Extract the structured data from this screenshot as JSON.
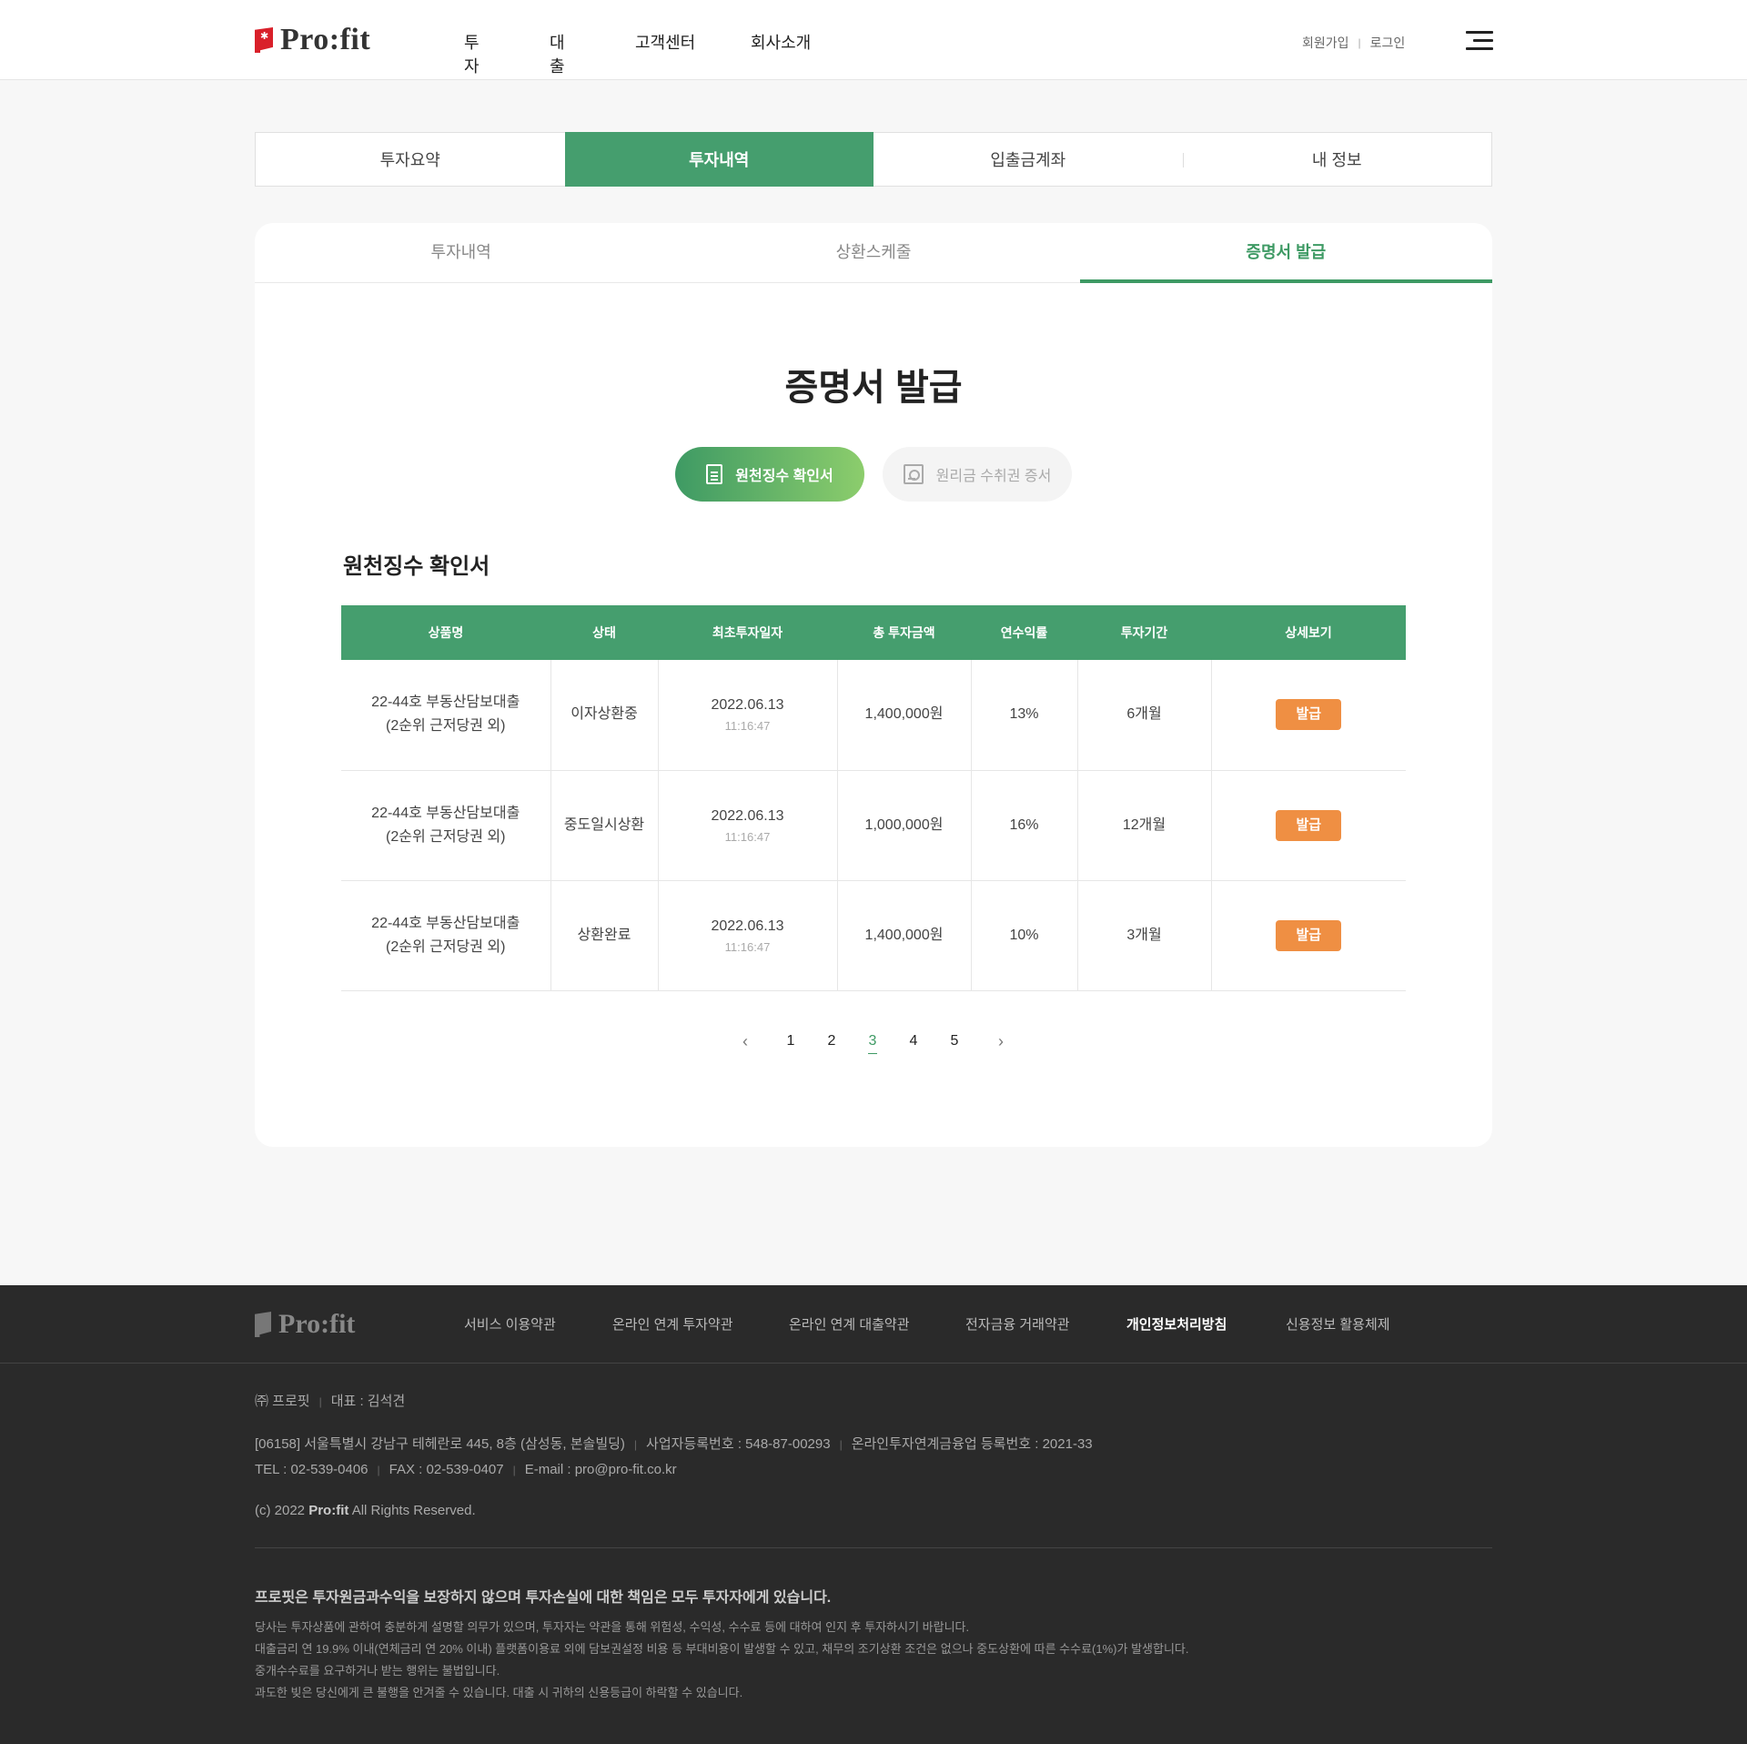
{
  "header": {
    "logo_text": "Pro:fit",
    "nav": [
      "투자",
      "대출",
      "고객센터",
      "회사소개"
    ],
    "signup": "회원가입",
    "login": "로그인"
  },
  "top_tabs": [
    "투자요약",
    "투자내역",
    "입출금계좌",
    "내 정보"
  ],
  "top_tabs_active": 1,
  "sub_tabs": [
    "투자내역",
    "상환스케줄",
    "증명서 발급"
  ],
  "sub_tabs_active": 2,
  "page_title": "증명서 발급",
  "toggle": {
    "primary": "원천징수 확인서",
    "secondary": "원리금 수취권 증서"
  },
  "section_title": "원천징수 확인서",
  "table": {
    "headers": [
      "상품명",
      "상태",
      "최초투자일자",
      "총 투자금액",
      "연수익률",
      "투자기간",
      "상세보기"
    ],
    "rows": [
      {
        "name1": "22-44호 부동산담보대출",
        "name2": "(2순위 근저당권 외)",
        "status": "이자상환중",
        "date": "2022.06.13",
        "time": "11:16:47",
        "amount": "1,400,000원",
        "rate": "13%",
        "period": "6개월",
        "action": "발급"
      },
      {
        "name1": "22-44호 부동산담보대출",
        "name2": "(2순위 근저당권 외)",
        "status": "중도일시상환",
        "date": "2022.06.13",
        "time": "11:16:47",
        "amount": "1,000,000원",
        "rate": "16%",
        "period": "12개월",
        "action": "발급"
      },
      {
        "name1": "22-44호 부동산담보대출",
        "name2": "(2순위 근저당권 외)",
        "status": "상환완료",
        "date": "2022.06.13",
        "time": "11:16:47",
        "amount": "1,400,000원",
        "rate": "10%",
        "period": "3개월",
        "action": "발급"
      }
    ]
  },
  "pagination": {
    "prev": "‹",
    "pages": [
      "1",
      "2",
      "3",
      "4",
      "5"
    ],
    "current": "3",
    "next": "›"
  },
  "footer": {
    "logo_text": "Pro:fit",
    "links": [
      "서비스 이용약관",
      "온라인 연계 투자약관",
      "온라인 연계 대출약관",
      "전자금융 거래약관",
      "개인정보처리방침",
      "신용정보 활용체제"
    ],
    "company": "㈜ 프로핏",
    "ceo": "대표 : 김석견",
    "address": "[06158] 서울특별시 강남구 테헤란로 445, 8층 (삼성동, 본솔빌딩)",
    "biz_no": "사업자등록번호 : 548-87-00293",
    "p2p_no": "온라인투자연계금융업 등록번호 : 2021-33",
    "tel": "TEL : 02-539-0406",
    "fax": "FAX : 02-539-0407",
    "email": "E-mail : pro@pro-fit.co.kr",
    "copy_prefix": "(c) 2022",
    "copy_brand": "Pro:fit",
    "copy_suffix": "All Rights Reserved.",
    "notice_title": "프로핏은 투자원금과수익을 보장하지 않으며 투자손실에 대한 책임은 모두 투자자에게 있습니다.",
    "notice_lines": [
      "당사는 투자상품에 관하여 충분하게 설명할 의무가 있으며, 투자자는 약관을 통해 위험성, 수익성, 수수료 등에 대하여 인지 후 투자하시기 바랍니다.",
      "대출금리 연 19.9% 이내(연체금리 연 20% 이내) 플랫폼이용료 외에 담보권설정 비용 등 부대비용이 발생할 수 있고, 채무의 조기상환 조건은 없으나 중도상환에 따른 수수료(1%)가 발생합니다.",
      "중개수수료를 요구하거나 받는 행위는 불법입니다.",
      "과도한 빚은 당신에게 큰 불행을 안겨줄 수 있습니다. 대출 시 귀하의 신용등급이 하락할 수 있습니다."
    ]
  },
  "colors": {
    "brand_green": "#459e6e",
    "brand_red": "#d9202a",
    "issue_orange": "#ef8f43",
    "footer_bg": "#2a2a2a"
  }
}
